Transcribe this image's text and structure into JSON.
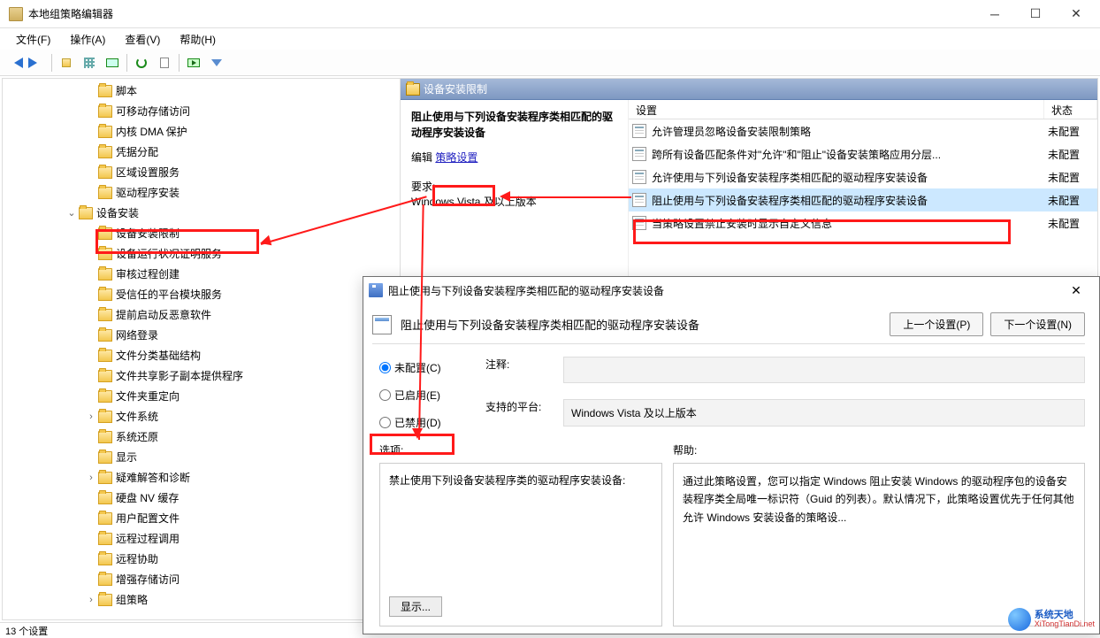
{
  "window": {
    "title": "本地组策略编辑器"
  },
  "menubar": [
    "文件(F)",
    "操作(A)",
    "查看(V)",
    "帮助(H)"
  ],
  "tree": {
    "items": [
      {
        "indent": 4,
        "label": "脚本"
      },
      {
        "indent": 4,
        "label": "可移动存储访问"
      },
      {
        "indent": 4,
        "label": "内核 DMA 保护"
      },
      {
        "indent": 4,
        "label": "凭据分配"
      },
      {
        "indent": 4,
        "label": "区域设置服务"
      },
      {
        "indent": 4,
        "label": "驱动程序安装"
      },
      {
        "indent": 3,
        "label": "设备安装",
        "exp": "⌄"
      },
      {
        "indent": 4,
        "label": "设备安装限制",
        "highlighted": true
      },
      {
        "indent": 4,
        "label": "设备运行状况证明服务"
      },
      {
        "indent": 4,
        "label": "审核过程创建"
      },
      {
        "indent": 4,
        "label": "受信任的平台模块服务"
      },
      {
        "indent": 4,
        "label": "提前启动反恶意软件"
      },
      {
        "indent": 4,
        "label": "网络登录"
      },
      {
        "indent": 4,
        "label": "文件分类基础结构"
      },
      {
        "indent": 4,
        "label": "文件共享影子副本提供程序"
      },
      {
        "indent": 4,
        "label": "文件夹重定向"
      },
      {
        "indent": 4,
        "label": "文件系统",
        "exp": "›"
      },
      {
        "indent": 4,
        "label": "系统还原"
      },
      {
        "indent": 4,
        "label": "显示"
      },
      {
        "indent": 4,
        "label": "疑难解答和诊断",
        "exp": "›"
      },
      {
        "indent": 4,
        "label": "硬盘 NV 缓存"
      },
      {
        "indent": 4,
        "label": "用户配置文件"
      },
      {
        "indent": 4,
        "label": "远程过程调用"
      },
      {
        "indent": 4,
        "label": "远程协助"
      },
      {
        "indent": 4,
        "label": "增强存储访问"
      },
      {
        "indent": 4,
        "label": "组策略",
        "exp": "›"
      }
    ]
  },
  "detail": {
    "folder_title": "设备安装限制",
    "setting_title": "阻止使用与下列设备安装程序类相匹配的驱动程序安装设备",
    "edit_label": "编辑",
    "policy_setting_link": "策略设置",
    "req_label": "要求:",
    "req_value": "Windows Vista 及以上版本",
    "columns": {
      "setting": "设置",
      "state": "状态"
    },
    "rows": [
      {
        "label": "允许管理员忽略设备安装限制策略",
        "state": "未配置"
      },
      {
        "label": "跨所有设备匹配条件对\"允许\"和\"阻止\"设备安装策略应用分层...",
        "state": "未配置"
      },
      {
        "label": "允许使用与下列设备安装程序类相匹配的驱动程序安装设备",
        "state": "未配置"
      },
      {
        "label": "阻止使用与下列设备安装程序类相匹配的驱动程序安装设备",
        "state": "未配置",
        "selected": true
      },
      {
        "label": "当策略设置禁止安装时显示自定义信息",
        "state": "未配置"
      }
    ]
  },
  "statusbar": "13 个设置",
  "dialog": {
    "title": "阻止使用与下列设备安装程序类相匹配的驱动程序安装设备",
    "policy_title": "阻止使用与下列设备安装程序类相匹配的驱动程序安装设备",
    "prev_btn": "上一个设置(P)",
    "next_btn": "下一个设置(N)",
    "radio_unconfigured": "未配置(C)",
    "radio_enabled": "已启用(E)",
    "radio_disabled": "已禁用(D)",
    "comment_label": "注释:",
    "platform_label": "支持的平台:",
    "platform_value": "Windows Vista 及以上版本",
    "options_label": "选项:",
    "help_label": "帮助:",
    "options_text": "禁止使用下列设备安装程序类的驱动程序安装设备:",
    "show_btn": "显示...",
    "help_text": "通过此策略设置，您可以指定 Windows 阻止安装 Windows 的驱动程序包的设备安装程序类全局唯一标识符（Guid 的列表）。默认情况下，此策略设置优先于任何其他允许 Windows 安装设备的策略设..."
  },
  "watermark": {
    "line1": "系统天地",
    "line2": "XiTongTianDi.net"
  }
}
